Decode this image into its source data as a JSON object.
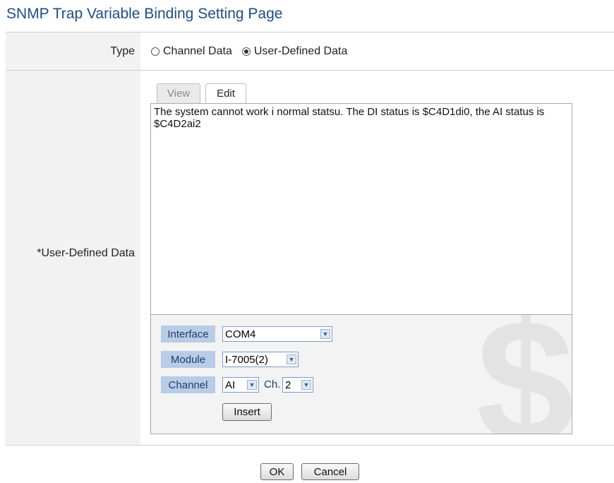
{
  "page": {
    "title": "SNMP Trap Variable Binding Setting Page"
  },
  "type_row": {
    "label": "Type",
    "options": [
      {
        "label": "Channel Data",
        "checked": false
      },
      {
        "label": "User-Defined Data",
        "checked": true
      }
    ]
  },
  "data_row": {
    "label": "*User-Defined Data",
    "tabs": [
      {
        "label": "View",
        "active": false
      },
      {
        "label": "Edit",
        "active": true
      }
    ],
    "editor_text": "The system cannot work i normal statsu. The DI status is $C4D1di0, the AI status is $C4D2ai2",
    "watermark": "$",
    "interface": {
      "label": "Interface",
      "value": "COM4"
    },
    "module": {
      "label": "Module",
      "value": "I-7005(2)"
    },
    "channel": {
      "label": "Channel",
      "type_value": "AI",
      "ch_label": "Ch.",
      "ch_value": "2"
    },
    "insert_label": "Insert"
  },
  "footer": {
    "ok_label": "OK",
    "cancel_label": "Cancel"
  },
  "colors": {
    "title": "#1f4d87",
    "panel_label_bg": "#b8cce8"
  },
  "icons": {
    "select_arrow": "chevron-down-icon",
    "radio": "radio-icon"
  }
}
